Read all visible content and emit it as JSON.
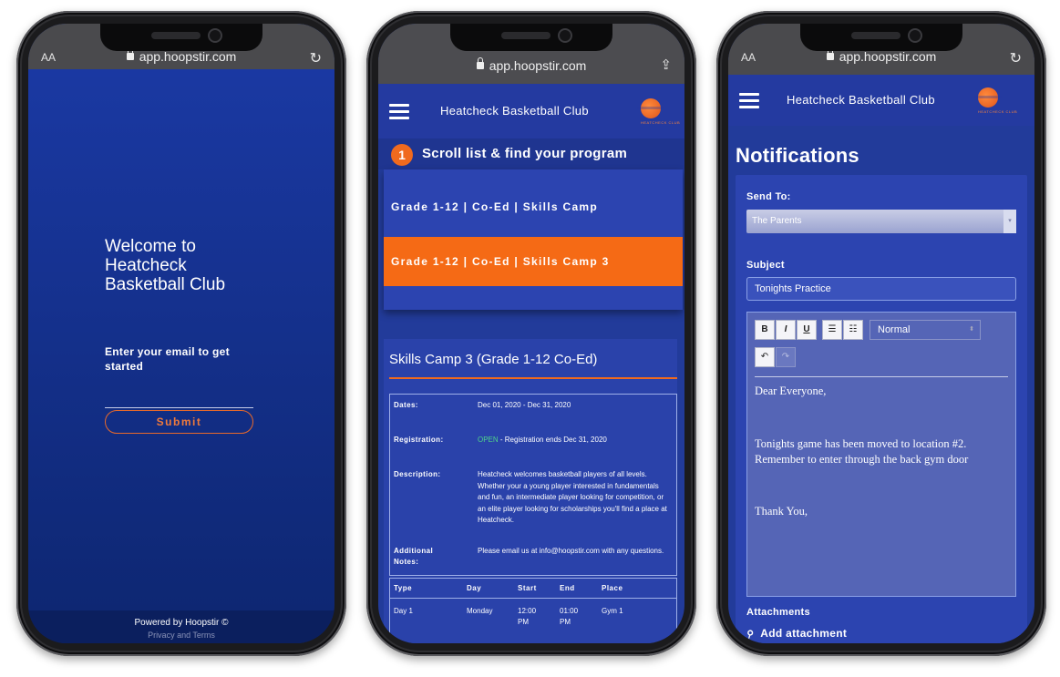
{
  "browser": {
    "aa": "AA",
    "url": "app.hoopstir.com"
  },
  "login": {
    "welcome": "Welcome to Heatcheck Basketball Club",
    "prompt": "Enter your email to get started",
    "submit": "Submit",
    "powered_by": "Powered by Hoopstir ©",
    "terms": "Privacy and Terms"
  },
  "club": {
    "name": "Heatcheck Basketball Club",
    "logo_text": "HEATCHECK CLUB"
  },
  "programs": {
    "step_number": "1",
    "step_text": "Scroll list & find your program",
    "items": [
      {
        "label": "Grade 1-12 | Co-Ed | Skills Camp"
      },
      {
        "label": "Grade 1-12 | Co-Ed | Skills Camp 3"
      }
    ],
    "detail": {
      "title": "Skills Camp 3 (Grade 1-12 Co-Ed)",
      "dates_label": "Dates:",
      "dates": "Dec 01, 2020 - Dec 31, 2020",
      "registration_label": "Registration:",
      "registration_status": "OPEN",
      "registration_text": " - Registration ends Dec 31, 2020",
      "description_label": "Description:",
      "description": "Heatcheck welcomes basketball players of all levels. Whether your a young player interested in fundamentals and fun, an intermediate player looking for competition, or an elite player looking for scholarships you'll find a place at Heatcheck.",
      "notes_label": "Additional Notes:",
      "notes": "Please email us at info@hoopstir.com with any questions.",
      "schedule_headers": [
        "Type",
        "Day",
        "Start",
        "End",
        "Place"
      ],
      "schedule_rows": [
        {
          "type": "Day 1",
          "day": "Monday",
          "start": "12:00 PM",
          "end": "01:00 PM",
          "place": "Gym 1"
        }
      ]
    }
  },
  "notifications": {
    "title": "Notifications",
    "send_to_label": "Send To:",
    "send_to_value": "The Parents",
    "subject_label": "Subject",
    "subject_value": "Tonights Practice",
    "toolbar": {
      "bold": "B",
      "italic": "I",
      "underline": "U",
      "format": "Normal"
    },
    "body_line1": "Dear Everyone,",
    "body_line2": "Tonights game has been moved to location #2.",
    "body_line3": "Remember to enter through the back gym door",
    "body_line4": "Thank You,",
    "attachments_label": "Attachments",
    "add_attachment": "Add attachment"
  },
  "colors": {
    "accent": "#f56a15",
    "primary": "#243aa0",
    "open": "#4fd38a"
  }
}
